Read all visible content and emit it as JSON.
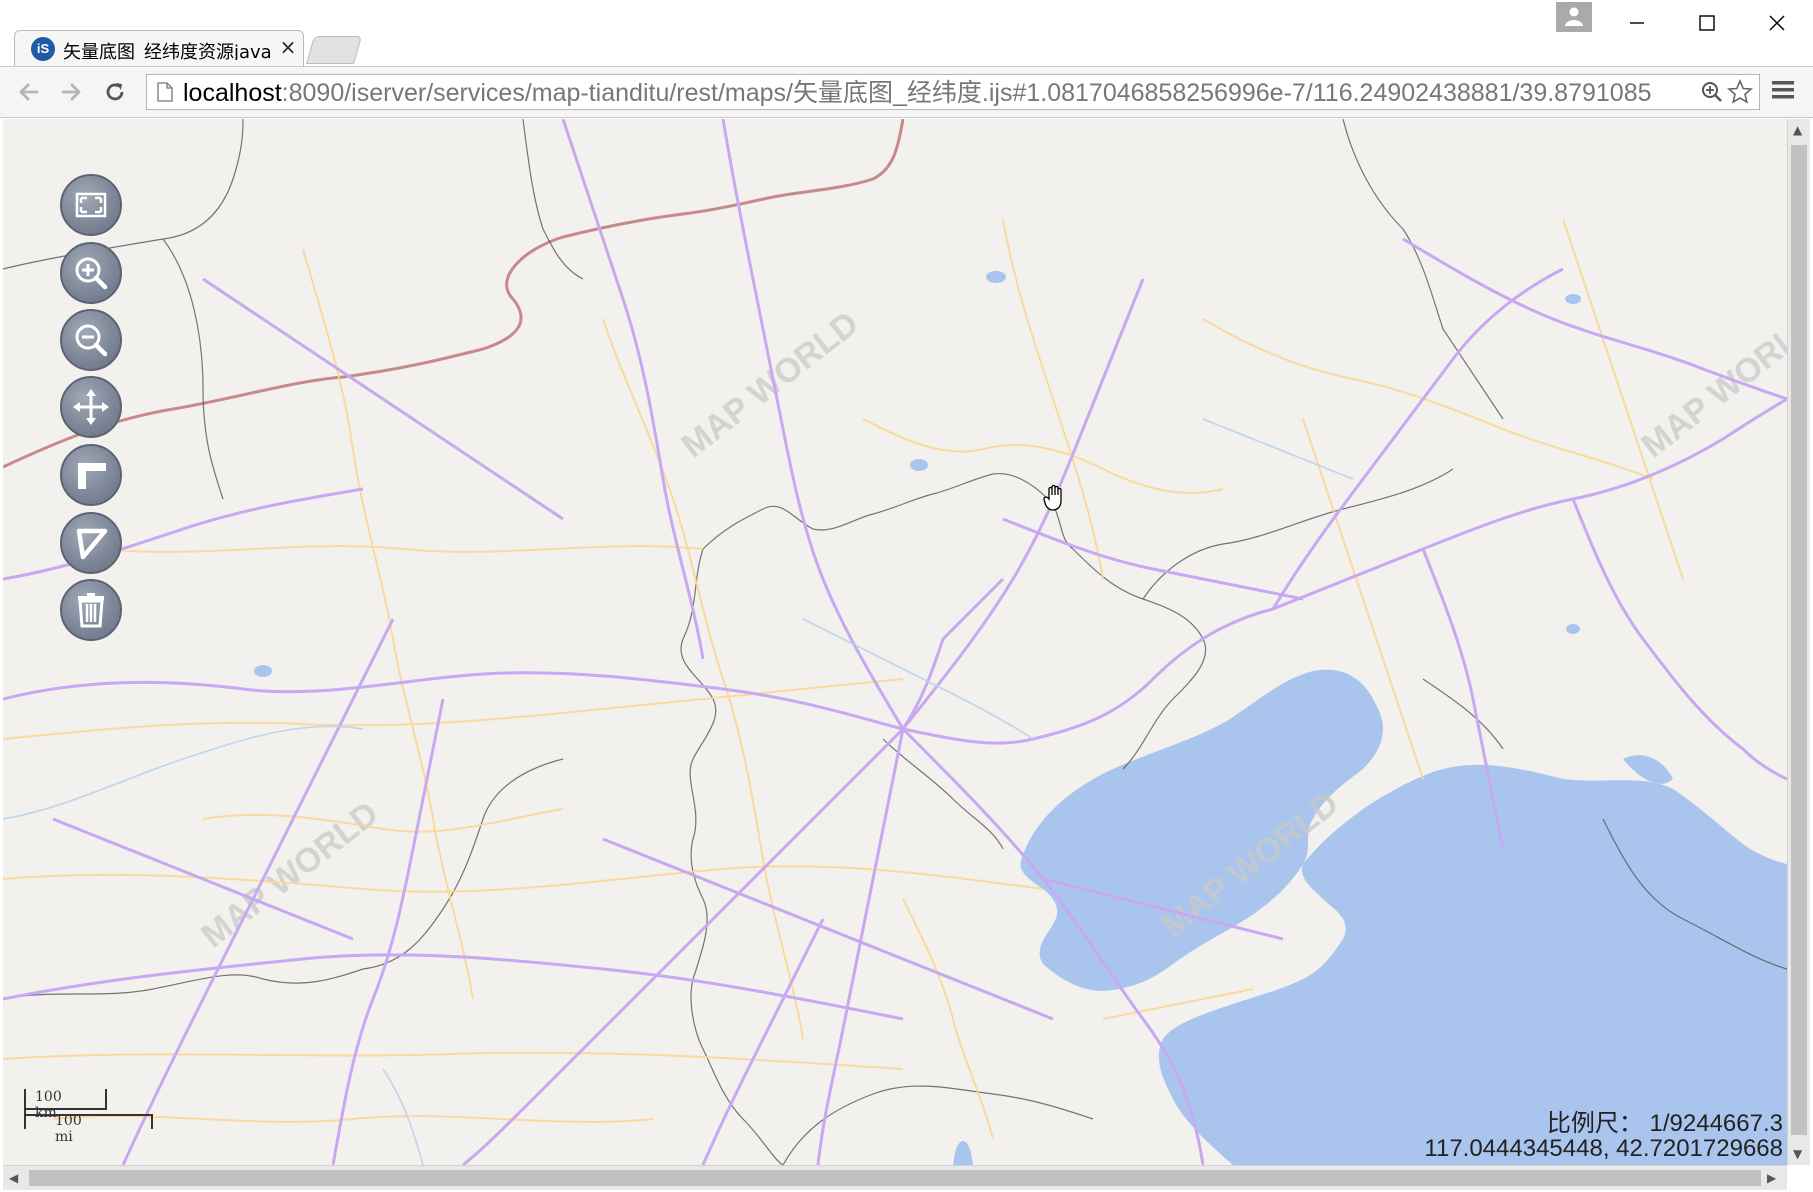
{
  "browser": {
    "tab": {
      "favicon_text": "iS",
      "title": "矢量底图_经纬度资源java",
      "close_glyph": "×"
    },
    "address_bar": {
      "host": "localhost",
      "rest": ":8090/iserver/services/map-tianditu/rest/maps/矢量底图_经纬度.ijs#1.0817046858256996e-7/116.24902438881/39.8791085"
    }
  },
  "map": {
    "watermark": "MAP WORLD",
    "controls": [
      {
        "name": "full-extent",
        "icon": "fullscreen-icon"
      },
      {
        "name": "zoom-in",
        "icon": "zoom-in-icon"
      },
      {
        "name": "zoom-out",
        "icon": "zoom-out-icon"
      },
      {
        "name": "pan",
        "icon": "pan-arrows-icon"
      },
      {
        "name": "measure-distance",
        "icon": "ruler-icon"
      },
      {
        "name": "measure-area",
        "icon": "area-triangle-icon"
      },
      {
        "name": "clear",
        "icon": "trash-icon"
      }
    ],
    "scale_bar": {
      "metric": "100 km",
      "imperial": "100 mi"
    },
    "scale_text": "比例尺：  1/9244667.3",
    "coordinates_text": "117.0444345448, 42.7201729668",
    "colors": {
      "land": "#f2f1ed",
      "sea": "#a9c5ee",
      "highway": "#c8a8f2",
      "road": "#fde2a6",
      "border": "#555555",
      "country_border": "#c8898b"
    }
  }
}
